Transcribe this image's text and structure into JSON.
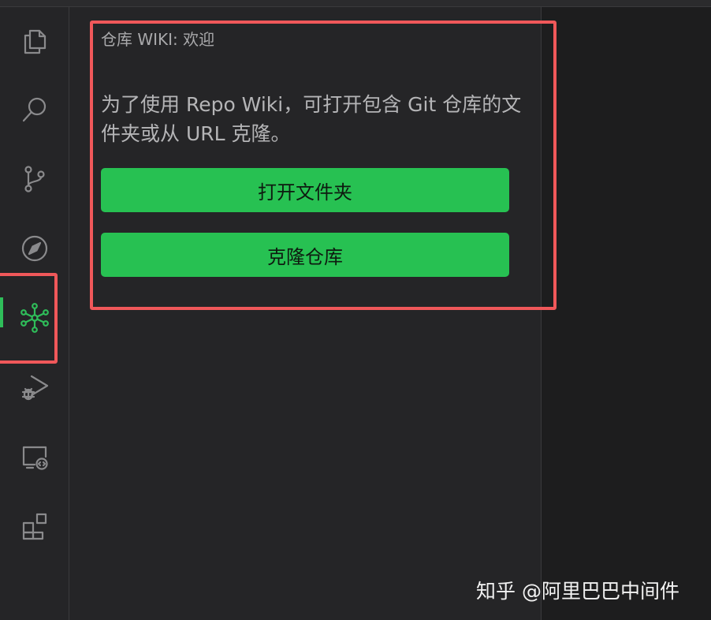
{
  "activity_bar": {
    "items": [
      {
        "name": "explorer",
        "icon": "files-icon"
      },
      {
        "name": "search",
        "icon": "search-icon"
      },
      {
        "name": "source-control",
        "icon": "source-control-icon"
      },
      {
        "name": "explore",
        "icon": "compass-icon"
      },
      {
        "name": "repo-wiki",
        "icon": "repo-wiki-graph-icon",
        "active": true
      },
      {
        "name": "run-debug",
        "icon": "run-debug-icon"
      },
      {
        "name": "remote",
        "icon": "remote-explorer-icon"
      },
      {
        "name": "extensions",
        "icon": "extensions-icon"
      }
    ],
    "active_color": "#2fbe5a"
  },
  "sidebar": {
    "title": "仓库 WIKI: 欢迎",
    "description": "为了使用 Repo Wiki，可打开包含 Git 仓库的文件夹或从 URL 克隆。",
    "open_folder_label": "打开文件夹",
    "clone_repo_label": "克隆仓库",
    "button_color": "#27c152"
  },
  "annotation": {
    "highlight_color": "#f0585a"
  },
  "watermark": {
    "text": "知乎 @阿里巴巴中间件"
  }
}
